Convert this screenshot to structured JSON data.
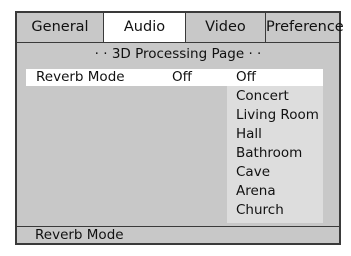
{
  "tabs": [
    "General",
    "Audio",
    "Video",
    "Preference"
  ],
  "active_tab": "Audio",
  "page_title": "· ·   3D Processing Page  · ·",
  "setting": {
    "label": "Reverb Mode",
    "value": "Off"
  },
  "options": [
    "Off",
    "Concert",
    "Living Room",
    "Hall",
    "Bathroom",
    "Cave",
    "Arena",
    "Church"
  ],
  "selected_option": "Off",
  "status_text": "Reverb Mode",
  "colors": {
    "background": "#c8c8c8",
    "highlight": "#ffffff",
    "border": "#3a3a3a",
    "list": "#dddddd"
  }
}
